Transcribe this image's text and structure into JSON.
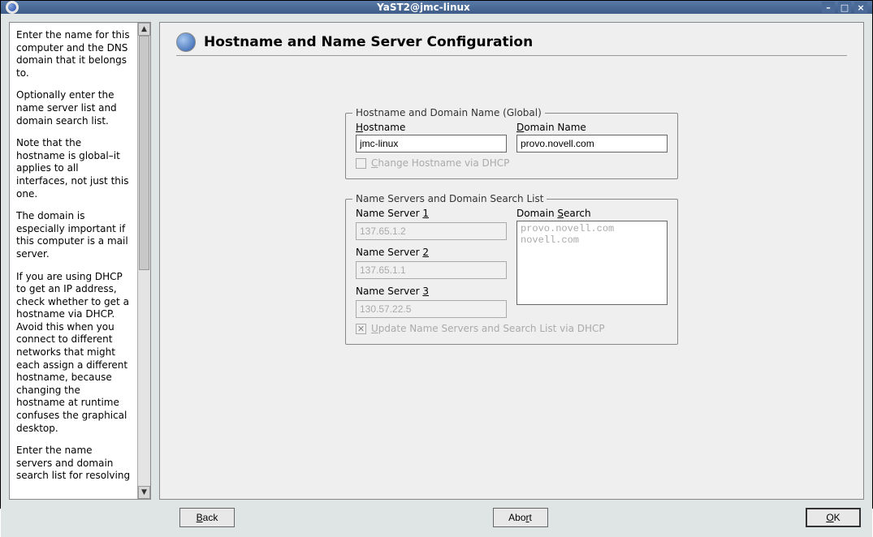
{
  "window": {
    "title": "YaST2@jmc-linux"
  },
  "help": {
    "p1": "Enter the name for this computer and the DNS domain that it belongs to.",
    "p2": "Optionally enter the name server list and domain search list.",
    "p3": "Note that the hostname is global–it applies to all interfaces, not just this one.",
    "p4": "The domain is especially important if this computer is a mail server.",
    "p5": "If you are using DHCP to get an IP address, check whether to get a hostname via DHCP. Avoid this when you connect to different networks that might each assign a different hostname, because changing the hostname at runtime confuses the graphical desktop.",
    "p6": "Enter the name servers and domain search list for resolving"
  },
  "page": {
    "title": "Hostname and Name Server Configuration"
  },
  "hostname_group": {
    "legend": "Hostname and Domain Name (Global)",
    "hostname_label_pre": "H",
    "hostname_label_rest": "ostname",
    "hostname_value": "jmc-linux",
    "domain_label_pre": "D",
    "domain_label_rest": "omain Name",
    "domain_value": "provo.novell.com",
    "dhcp_label_pre": "C",
    "dhcp_label_rest": "hange Hostname via DHCP"
  },
  "ns_group": {
    "legend": "Name Servers and Domain Search List",
    "ns1_label": "Name Server ",
    "ns1_accel": "1",
    "ns1_value": "137.65.1.2",
    "ns2_label": "Name Server ",
    "ns2_accel": "2",
    "ns2_value": "137.65.1.1",
    "ns3_label": "Name Server ",
    "ns3_accel": "3",
    "ns3_value": "130.57.22.5",
    "search_label": "Domain ",
    "search_accel": "S",
    "search_rest": "earch",
    "search_value": "provo.novell.com\nnovell.com",
    "update_label_pre": "U",
    "update_label_rest": "pdate Name Servers and Search List via DHCP"
  },
  "buttons": {
    "back_pre": "B",
    "back_rest": "ack",
    "abort_pre": "",
    "abort_mid": "Abo",
    "abort_accel": "r",
    "abort_rest": "t",
    "ok_pre": "O",
    "ok_rest": "K"
  }
}
